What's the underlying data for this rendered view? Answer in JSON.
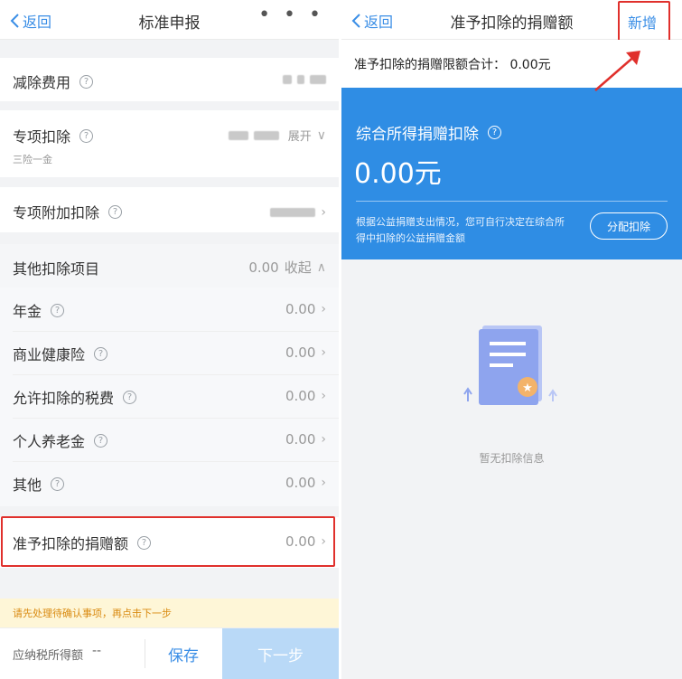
{
  "left": {
    "nav": {
      "back": "返回",
      "title": "标准申报",
      "more": "• • •"
    },
    "rows": {
      "reduce": {
        "label": "减除费用"
      },
      "special": {
        "label": "专项扣除",
        "sub": "三险一金",
        "toggle": "展开"
      },
      "special_add": {
        "label": "专项附加扣除"
      },
      "other": {
        "label": "其他扣除项目",
        "value": "0.00",
        "toggle": "收起"
      },
      "items": [
        {
          "label": "年金",
          "value": "0.00"
        },
        {
          "label": "商业健康险",
          "value": "0.00"
        },
        {
          "label": "允许扣除的税费",
          "value": "0.00"
        },
        {
          "label": "个人养老金",
          "value": "0.00"
        },
        {
          "label": "其他",
          "value": "0.00"
        }
      ],
      "donation": {
        "label": "准予扣除的捐赠额",
        "value": "0.00"
      }
    },
    "notice": "请先处理待确认事项，再点击下一步",
    "footer": {
      "label": "应纳税所得额",
      "dash": "--",
      "save": "保存",
      "next": "下一步"
    }
  },
  "right": {
    "nav": {
      "back": "返回",
      "title": "准予扣除的捐赠额",
      "add": "新增"
    },
    "limit": "准予扣除的捐赠限额合计：  0.00元",
    "card": {
      "title": "综合所得捐赠扣除",
      "amount": "0.00元",
      "note": "根据公益捐赠支出情况，您可自行决定在综合所得中扣除的公益捐赠金额",
      "button": "分配扣除"
    },
    "empty": "暂无扣除信息"
  },
  "colors": {
    "accent": "#3a8ee6",
    "card_blue": "#2f8de4",
    "highlight_red": "#e0302c",
    "notice_bg": "#fef6d7"
  }
}
